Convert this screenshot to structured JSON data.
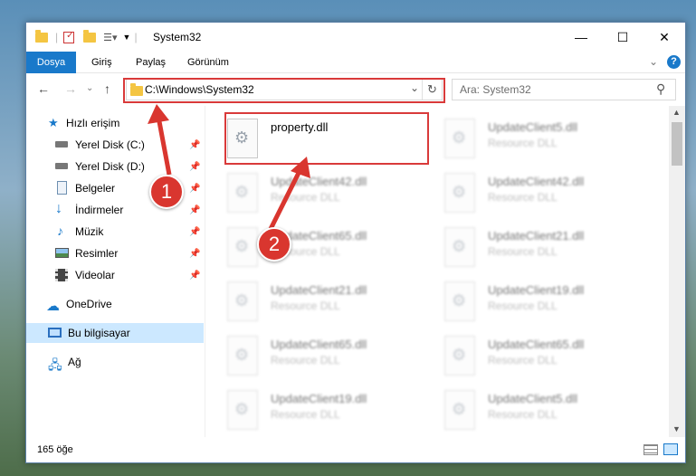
{
  "titlebar": {
    "title": "System32",
    "minimize_glyph": "—",
    "maximize_glyph": "☐",
    "close_glyph": "✕"
  },
  "ribbon": {
    "tabs": [
      "Dosya",
      "Giriş",
      "Paylaş",
      "Görünüm"
    ],
    "help_glyph": "?"
  },
  "address": {
    "path": "C:\\Windows\\System32",
    "back_glyph": "←",
    "forward_glyph": "→",
    "up_glyph": "↑",
    "dropdown_glyph": "⌄",
    "refresh_glyph": "↻"
  },
  "search": {
    "placeholder": "Ara: System32",
    "icon_glyph": "⚲"
  },
  "sidebar": {
    "quick_access": "Hızlı erişim",
    "items": [
      {
        "label": "Yerel Disk (C:)",
        "icon": "drive-icon"
      },
      {
        "label": "Yerel Disk (D:)",
        "icon": "drive-icon"
      },
      {
        "label": "Belgeler",
        "icon": "documents-icon"
      },
      {
        "label": "İndirmeler",
        "icon": "downloads-icon"
      },
      {
        "label": "Müzik",
        "icon": "music-icon"
      },
      {
        "label": "Resimler",
        "icon": "pictures-icon"
      },
      {
        "label": "Videolar",
        "icon": "videos-icon"
      }
    ],
    "onedrive": "OneDrive",
    "this_pc": "Bu bilgisayar",
    "network": "Ağ",
    "pin_glyph": "📌"
  },
  "files": [
    {
      "name": "property.dll",
      "type": ""
    },
    {
      "name": "UpdateClient5.dll",
      "type": "Resource DLL"
    },
    {
      "name": "UpdateClient42.dll",
      "type": "Resource DLL"
    },
    {
      "name": "UpdateClient42.dll",
      "type": "Resource DLL"
    },
    {
      "name": "UpdateClient65.dll",
      "type": "Resource DLL"
    },
    {
      "name": "UpdateClient21.dll",
      "type": "Resource DLL"
    },
    {
      "name": "UpdateClient21.dll",
      "type": "Resource DLL"
    },
    {
      "name": "UpdateClient19.dll",
      "type": "Resource DLL"
    },
    {
      "name": "UpdateClient65.dll",
      "type": "Resource DLL"
    },
    {
      "name": "UpdateClient65.dll",
      "type": "Resource DLL"
    },
    {
      "name": "UpdateClient19.dll",
      "type": "Resource DLL"
    },
    {
      "name": "UpdateClient5.dll",
      "type": "Resource DLL"
    }
  ],
  "status": {
    "item_count": "165 öğe"
  },
  "annotations": {
    "step1": "1",
    "step2": "2",
    "color": "#d9362f"
  },
  "colors": {
    "file_tab": "#1979ca",
    "selected": "#cce8ff"
  }
}
